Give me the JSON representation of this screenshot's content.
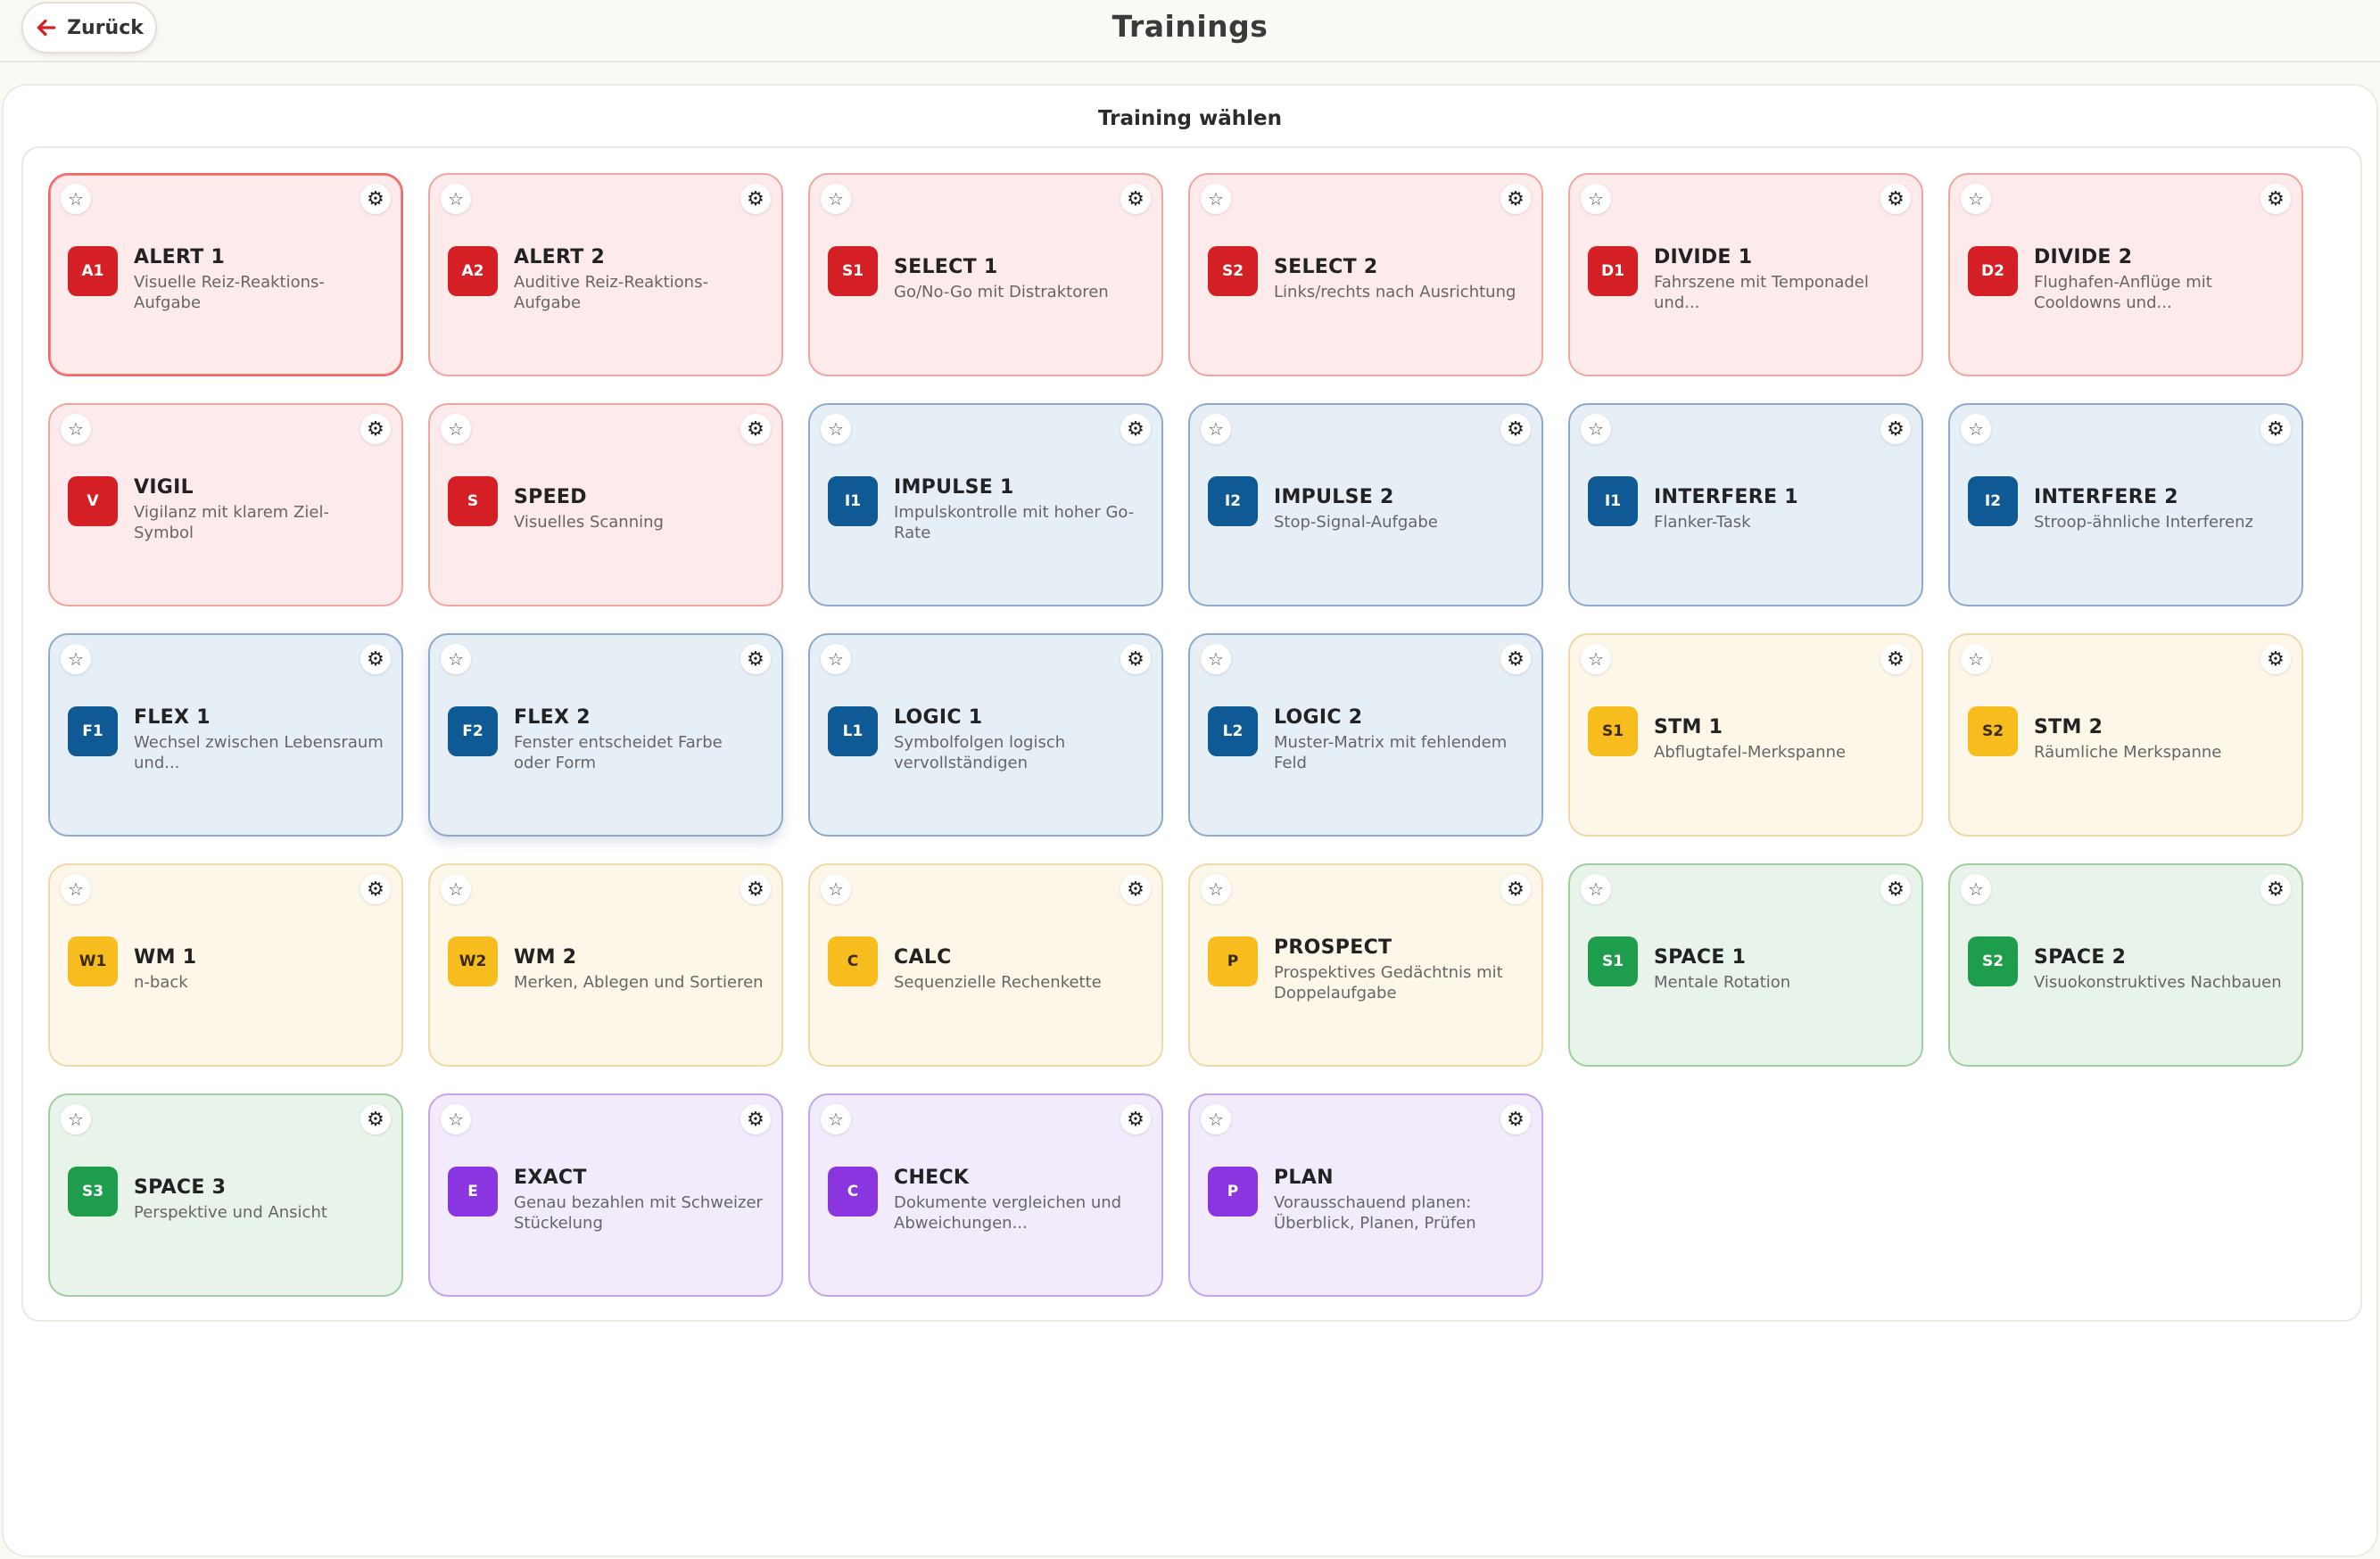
{
  "header": {
    "back_label": "Zurück",
    "title": "Trainings"
  },
  "main": {
    "panel_title": "Training wählen",
    "cards": [
      {
        "code": "A1",
        "title": "ALERT 1",
        "desc": "Visuelle Reiz-Reaktions-Aufgabe",
        "color": "red"
      },
      {
        "code": "A2",
        "title": "ALERT 2",
        "desc": "Auditive Reiz-Reaktions-Aufgabe",
        "color": "red"
      },
      {
        "code": "S1",
        "title": "SELECT 1",
        "desc": "Go/No-Go mit Distraktoren",
        "color": "red"
      },
      {
        "code": "S2",
        "title": "SELECT 2",
        "desc": "Links/rechts nach Ausrichtung",
        "color": "red"
      },
      {
        "code": "D1",
        "title": "DIVIDE 1",
        "desc": "Fahrszene mit Temponadel und...",
        "color": "red"
      },
      {
        "code": "D2",
        "title": "DIVIDE 2",
        "desc": "Flughafen-Anflüge mit Cooldowns und...",
        "color": "red"
      },
      {
        "code": "V",
        "title": "VIGIL",
        "desc": "Vigilanz mit klarem Ziel-Symbol",
        "color": "red"
      },
      {
        "code": "S",
        "title": "SPEED",
        "desc": "Visuelles Scanning",
        "color": "red"
      },
      {
        "code": "I1",
        "title": "IMPULSE 1",
        "desc": "Impulskontrolle mit hoher Go-Rate",
        "color": "blue"
      },
      {
        "code": "I2",
        "title": "IMPULSE 2",
        "desc": "Stop-Signal-Aufgabe",
        "color": "blue"
      },
      {
        "code": "I1",
        "title": "INTERFERE 1",
        "desc": "Flanker-Task",
        "color": "blue"
      },
      {
        "code": "I2",
        "title": "INTERFERE 2",
        "desc": "Stroop-ähnliche Interferenz",
        "color": "blue"
      },
      {
        "code": "F1",
        "title": "FLEX 1",
        "desc": "Wechsel zwischen Lebensraum und...",
        "color": "blue"
      },
      {
        "code": "F2",
        "title": "FLEX 2",
        "desc": "Fenster entscheidet Farbe oder Form",
        "color": "blue"
      },
      {
        "code": "L1",
        "title": "LOGIC 1",
        "desc": "Symbolfolgen logisch vervollständigen",
        "color": "blue"
      },
      {
        "code": "L2",
        "title": "LOGIC 2",
        "desc": "Muster-Matrix mit fehlendem Feld",
        "color": "blue"
      },
      {
        "code": "S1",
        "title": "STM 1",
        "desc": "Abflugtafel-Merkspanne",
        "color": "yellow"
      },
      {
        "code": "S2",
        "title": "STM 2",
        "desc": "Räumliche Merkspanne",
        "color": "yellow"
      },
      {
        "code": "W1",
        "title": "WM 1",
        "desc": "n-back",
        "color": "yellow"
      },
      {
        "code": "W2",
        "title": "WM 2",
        "desc": "Merken, Ablegen und Sortieren",
        "color": "yellow"
      },
      {
        "code": "C",
        "title": "CALC",
        "desc": "Sequenzielle Rechenkette",
        "color": "yellow"
      },
      {
        "code": "P",
        "title": "PROSPECT",
        "desc": "Prospektives Gedächtnis mit Doppelaufgabe",
        "color": "yellow"
      },
      {
        "code": "S1",
        "title": "SPACE 1",
        "desc": "Mentale Rotation",
        "color": "green"
      },
      {
        "code": "S2",
        "title": "SPACE 2",
        "desc": "Visuokonstruktives Nachbauen",
        "color": "green"
      },
      {
        "code": "S3",
        "title": "SPACE 3",
        "desc": "Perspektive und Ansicht",
        "color": "green"
      },
      {
        "code": "E",
        "title": "EXACT",
        "desc": "Genau bezahlen mit Schweizer Stückelung",
        "color": "purple"
      },
      {
        "code": "C",
        "title": "CHECK",
        "desc": "Dokumente vergleichen und Abweichungen...",
        "color": "purple"
      },
      {
        "code": "P",
        "title": "PLAN",
        "desc": "Vorausschauend planen: Überblick, Planen, Prüfen",
        "color": "purple"
      }
    ]
  },
  "icons": {
    "back": "arrow-left-icon",
    "favorite": "star-icon",
    "settings": "gear-icon",
    "star_glyph": "☆",
    "gear_glyph": "⚙"
  },
  "colors": {
    "red": "#d42024",
    "blue": "#0f5995",
    "yellow": "#f7bd1e",
    "green": "#1e9e4c",
    "purple": "#8a35e0"
  }
}
